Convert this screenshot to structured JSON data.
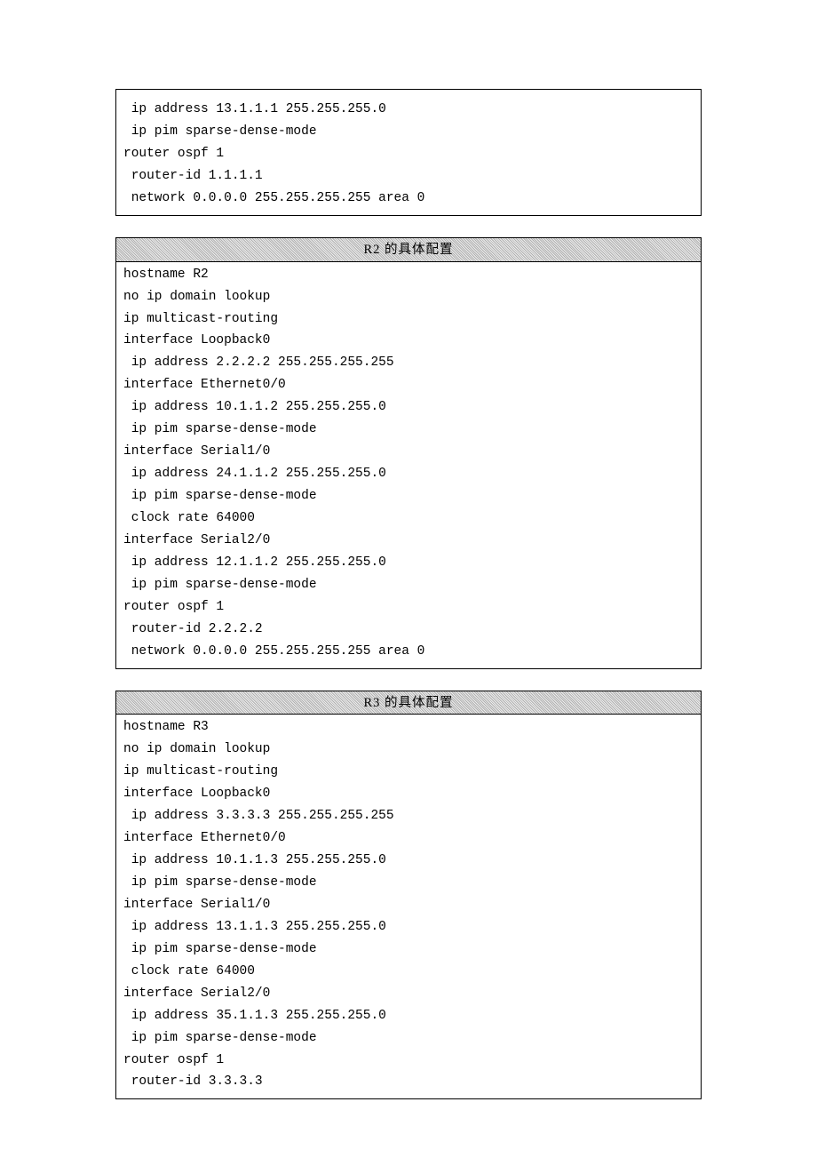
{
  "block1": {
    "body": " ip address 13.1.1.1 255.255.255.0\n ip pim sparse-dense-mode\nrouter ospf 1\n router-id 1.1.1.1\n network 0.0.0.0 255.255.255.255 area 0"
  },
  "block2": {
    "header": "R2 的具体配置",
    "body": "hostname R2\nno ip domain lookup\nip multicast-routing\ninterface Loopback0\n ip address 2.2.2.2 255.255.255.255\ninterface Ethernet0/0\n ip address 10.1.1.2 255.255.255.0\n ip pim sparse-dense-mode\ninterface Serial1/0\n ip address 24.1.1.2 255.255.255.0\n ip pim sparse-dense-mode\n clock rate 64000\ninterface Serial2/0\n ip address 12.1.1.2 255.255.255.0\n ip pim sparse-dense-mode\nrouter ospf 1\n router-id 2.2.2.2\n network 0.0.0.0 255.255.255.255 area 0"
  },
  "block3": {
    "header": "R3 的具体配置",
    "body": "hostname R3\nno ip domain lookup\nip multicast-routing\ninterface Loopback0\n ip address 3.3.3.3 255.255.255.255\ninterface Ethernet0/0\n ip address 10.1.1.3 255.255.255.0\n ip pim sparse-dense-mode\ninterface Serial1/0\n ip address 13.1.1.3 255.255.255.0\n ip pim sparse-dense-mode\n clock rate 64000\ninterface Serial2/0\n ip address 35.1.1.3 255.255.255.0\n ip pim sparse-dense-mode\nrouter ospf 1\n router-id 3.3.3.3"
  }
}
